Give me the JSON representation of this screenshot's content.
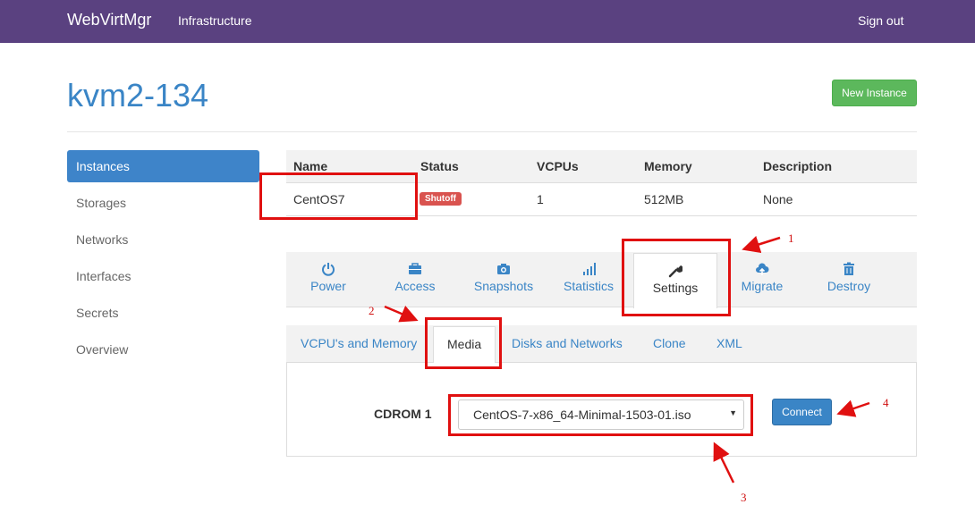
{
  "navbar": {
    "brand": "WebVirtMgr",
    "infrastructure": "Infrastructure",
    "signout": "Sign out"
  },
  "page": {
    "title": "kvm2-134",
    "new_instance_label": "New Instance"
  },
  "sidebar": {
    "items": [
      {
        "label": "Instances",
        "active": true
      },
      {
        "label": "Storages"
      },
      {
        "label": "Networks"
      },
      {
        "label": "Interfaces"
      },
      {
        "label": "Secrets"
      },
      {
        "label": "Overview"
      }
    ]
  },
  "table": {
    "headers": [
      "Name",
      "Status",
      "VCPUs",
      "Memory",
      "Description"
    ],
    "row": {
      "name": "CentOS7",
      "status": "Shutoff",
      "vcpus": "1",
      "memory": "512MB",
      "description": "None"
    }
  },
  "tabs": [
    {
      "label": "Power",
      "icon": "power-icon"
    },
    {
      "label": "Access",
      "icon": "briefcase-icon"
    },
    {
      "label": "Snapshots",
      "icon": "camera-icon"
    },
    {
      "label": "Statistics",
      "icon": "bar-chart-icon"
    },
    {
      "label": "Settings",
      "icon": "wrench-icon",
      "active": true
    },
    {
      "label": "Migrate",
      "icon": "cloud-upload-icon"
    },
    {
      "label": "Destroy",
      "icon": "trash-icon"
    }
  ],
  "subtabs": [
    {
      "label": "VCPU's and Memory"
    },
    {
      "label": "Media",
      "active": true
    },
    {
      "label": "Disks and Networks"
    },
    {
      "label": "Clone"
    },
    {
      "label": "XML"
    }
  ],
  "media": {
    "cdrom_label": "CDROM 1",
    "selected_iso": "CentOS-7-x86_64-Minimal-1503-01.iso",
    "connect_label": "Connect"
  },
  "annotations": [
    "1",
    "2",
    "3",
    "4"
  ],
  "colors": {
    "navbar": "#5a4180",
    "accent": "#3a85c6",
    "success": "#5cb85c",
    "danger": "#d9534f",
    "annotation": "#e01010"
  }
}
